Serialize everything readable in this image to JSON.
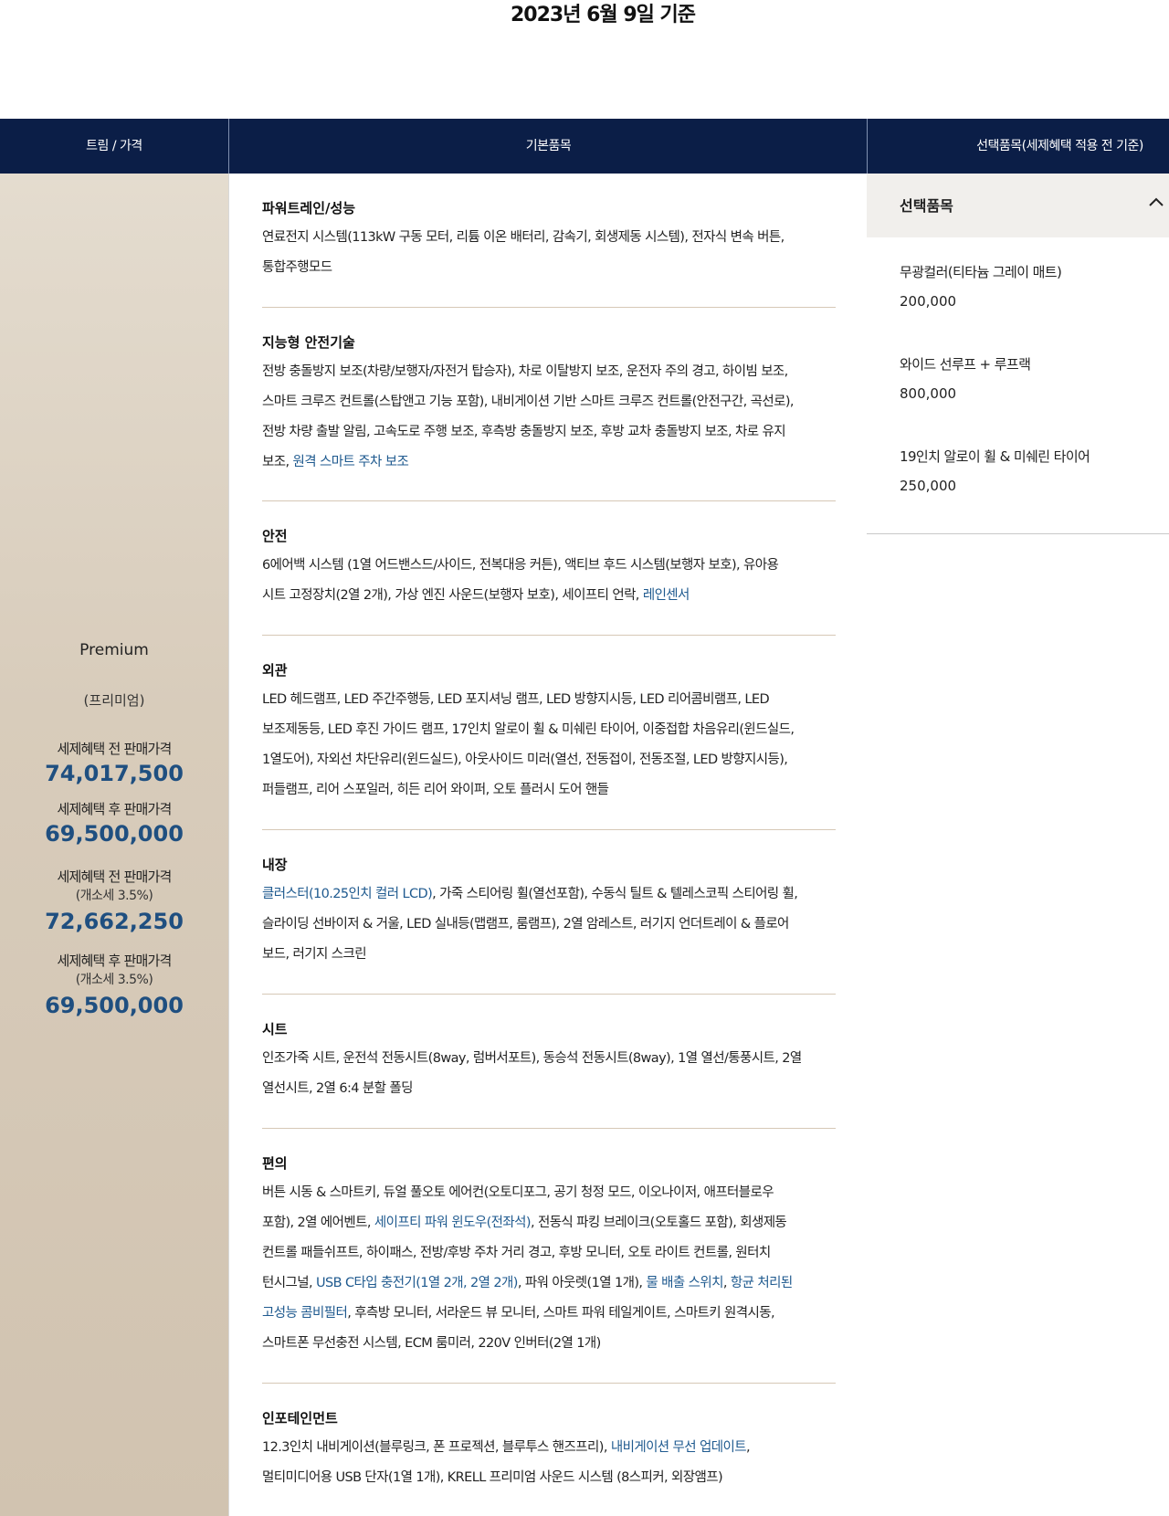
{
  "date_title": "2023년 6월 9일 기준",
  "header": {
    "trim_price": "트림 / 가격",
    "basic_items": "기본품목",
    "option_items": "선택품목(세제혜택 적용 전 기준)"
  },
  "trim": {
    "name": "Premium",
    "name_ko": "(프리미엄)",
    "prices": [
      {
        "label": "세제혜택 전 판매가격",
        "sub": "",
        "value": "74,017,500"
      },
      {
        "label": "세제혜택 후 판매가격",
        "sub": "",
        "value": "69,500,000"
      },
      {
        "label": "세제혜택 전 판매가격",
        "sub": "(개소세 3.5%)",
        "value": "72,662,250"
      },
      {
        "label": "세제혜택 후 판매가격",
        "sub": "(개소세 3.5%)",
        "value": "69,500,000"
      }
    ]
  },
  "sections": [
    {
      "title": "파워트레인/성능",
      "lines": [
        "연료전지 시스템(113kW 구동 모터, 리튬 이온 배터리, 감속기, 회생제동 시스템), 전자식 변속 버튼,",
        "통합주행모드"
      ]
    },
    {
      "title": "지능형 안전기술",
      "lines": [
        "전방 충돌방지 보조(차량/보행자/자전거 탑승자), 차로 이탈방지 보조, 운전자 주의 경고, 하이빔 보조,",
        "스마트 크루즈 컨트롤(스탑앤고 기능 포함), 내비게이션 기반 스마트 크루즈 컨트롤(안전구간, 곡선로),",
        "전방 차량 출발 알림, 고속도로 주행 보조, 후측방 충돌방지 보조, 후방 교차 충돌방지 보조, 차로 유지",
        "보조, "
      ],
      "highlight": "원격 스마트 주차 보조"
    },
    {
      "title": "안전",
      "lines": [
        "6에어백 시스템 (1열 어드밴스드/사이드, 전복대응 커튼), 액티브 후드 시스템(보행자 보호), 유아용",
        "시트 고정장치(2열 2개), 가상 엔진 사운드(보행자 보호), 세이프티 언락, "
      ],
      "highlight": "레인센서"
    },
    {
      "title": "외관",
      "lines": [
        "LED 헤드램프, LED 주간주행등, LED 포지셔닝 램프, LED 방향지시등, LED 리어콤비램프, LED",
        "보조제동등, LED 후진 가이드 램프, 17인치 알로이 휠 & 미쉐린 타이어, 이중접합 차음유리(윈드실드,",
        "1열도어), 자외선 차단유리(윈드실드), 아웃사이드 미러(열선, 전동접이, 전동조절, LED 방향지시등),",
        "퍼들램프, 리어 스포일러, 히든 리어 와이퍼, 오토 플러시 도어 핸들"
      ]
    },
    {
      "title": "내장",
      "highlight_start": "클러스터(10.25인치 컬러 LCD)",
      "lines": [
        ", 가죽 스티어링 휠(열선포함), 수동식 틸트 & 텔레스코픽 스티어링 휠,",
        "슬라이딩 선바이저 & 거울, LED 실내등(맵램프, 룸램프), 2열 암레스트, 러기지 언더트레이 & 플로어",
        "보드, 러기지 스크린"
      ]
    },
    {
      "title": "시트",
      "lines": [
        "인조가죽 시트, 운전석 전동시트(8way, 럼버서포트), 동승석 전동시트(8way), 1열 열선/통풍시트, 2열",
        "열선시트, 2열 6:4 분할 폴딩"
      ]
    },
    {
      "title": "편의",
      "parts": {
        "l1": "버튼 시동 & 스마트키, 듀얼 풀오토 에어컨(오토디포그, 공기 청정 모드, 이오나이저, 애프터블로우",
        "l2a": "포함), 2열 에어벤트, ",
        "l2h": "세이프티 파워 윈도우(전좌석)",
        "l2b": ", 전동식 파킹 브레이크(오토홀드 포함), 회생제동",
        "l3": "컨트롤 패들쉬프트, 하이패스, 전방/후방 주차 거리 경고, 후방 모니터, 오토 라이트 컨트롤, 원터치",
        "l4a": "턴시그널, ",
        "l4h1": "USB C타입 충전기(1열 2개, 2열 2개)",
        "l4b": ", 파워 아웃렛(1열 1개), ",
        "l4h2": "물 배출 스위치",
        "l4c": ", ",
        "l4h3": "항균 처리된",
        "l5h": "고성능 콤비필터",
        "l5b": ", 후측방 모니터, 서라운드 뷰 모니터, 스마트 파워 테일게이트, 스마트키 원격시동,",
        "l6": "스마트폰 무선충전 시스템, ECM 룸미러, 220V 인버터(2열 1개)"
      }
    },
    {
      "title": "인포테인먼트",
      "parts": {
        "l1a": "12.3인치 내비게이션(블루링크, 폰 프로젝션, 블루투스 핸즈프리), ",
        "l1h": "내비게이션 무선 업데이트",
        "l1b": ",",
        "l2": "멀티미디어용 USB 단자(1열 1개), KRELL 프리미엄 사운드 시스템 (8스피커, 외장앰프)"
      }
    }
  ],
  "options": {
    "header": "선택품목",
    "chevron_icon": "chevron-up-icon",
    "items": [
      {
        "name": "무광컬러(티타늄 그레이 매트)",
        "price": "200,000"
      },
      {
        "name": "와이드 선루프 + 루프랙",
        "price": "800,000"
      },
      {
        "name": "19인치 알로이 휠 & 미쉐린 타이어",
        "price": "250,000"
      }
    ]
  },
  "colors": {
    "header_bg": "#0b1e47",
    "price_blue": "#1f4f80",
    "link_blue": "#1f5a8f",
    "trim_bg": "#d8ccbb"
  }
}
